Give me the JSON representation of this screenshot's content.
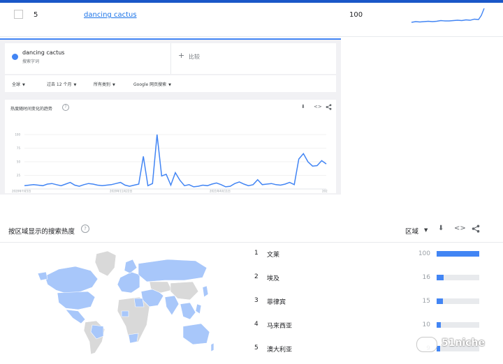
{
  "top_row": {
    "index": "5",
    "query_link": "dancing cactus",
    "score": "100"
  },
  "term": {
    "name": "dancing cactus",
    "subtitle": "搜索字词",
    "color": "#4285f4"
  },
  "compare": {
    "plus": "+",
    "label": "比较"
  },
  "filters": {
    "region": "全球",
    "time": "过去 12 个月",
    "category": "所有类别",
    "search_type": "Google 网页搜索"
  },
  "chart_card": {
    "title": "热度随时间变化的趋势",
    "help_icon": "question-mark",
    "tools": [
      "download-icon",
      "embed-icon",
      "share-icon"
    ]
  },
  "chart_data": {
    "type": "line",
    "series": [
      {
        "values": [
          6,
          7,
          8,
          7,
          6,
          9,
          10,
          8,
          6,
          9,
          12,
          7,
          5,
          8,
          10,
          9,
          7,
          6,
          7,
          8,
          10,
          12,
          7,
          5,
          7,
          9,
          60,
          6,
          10,
          100,
          24,
          27,
          7,
          30,
          16,
          6,
          8,
          4,
          5,
          7,
          6,
          9,
          11,
          8,
          4,
          5,
          10,
          13,
          9,
          6,
          8,
          17,
          8,
          9,
          10,
          8,
          7,
          9,
          12,
          8,
          55,
          65,
          50,
          42,
          43,
          52,
          46
        ]
      }
    ],
    "x_tick_labels": [
      "2020年7月5日",
      "2020年11月22日",
      "2021年4月11日",
      "202"
    ],
    "y_tick_labels": [
      "100",
      "75",
      "50",
      "25"
    ],
    "ylim": [
      0,
      100
    ],
    "grid": true,
    "line_color": "#4285f4"
  },
  "region": {
    "title": "按区域显示的搜索热度",
    "select_label": "区域",
    "rows": [
      {
        "rank": "1",
        "name": "文莱",
        "value": 100
      },
      {
        "rank": "2",
        "name": "埃及",
        "value": 16
      },
      {
        "rank": "3",
        "name": "菲律宾",
        "value": 15
      },
      {
        "rank": "4",
        "name": "马来西亚",
        "value": 10
      },
      {
        "rank": "5",
        "name": "澳大利亚",
        "value": 9
      }
    ],
    "bar_color": "#4285f4"
  },
  "watermark": {
    "text": "51niche"
  }
}
